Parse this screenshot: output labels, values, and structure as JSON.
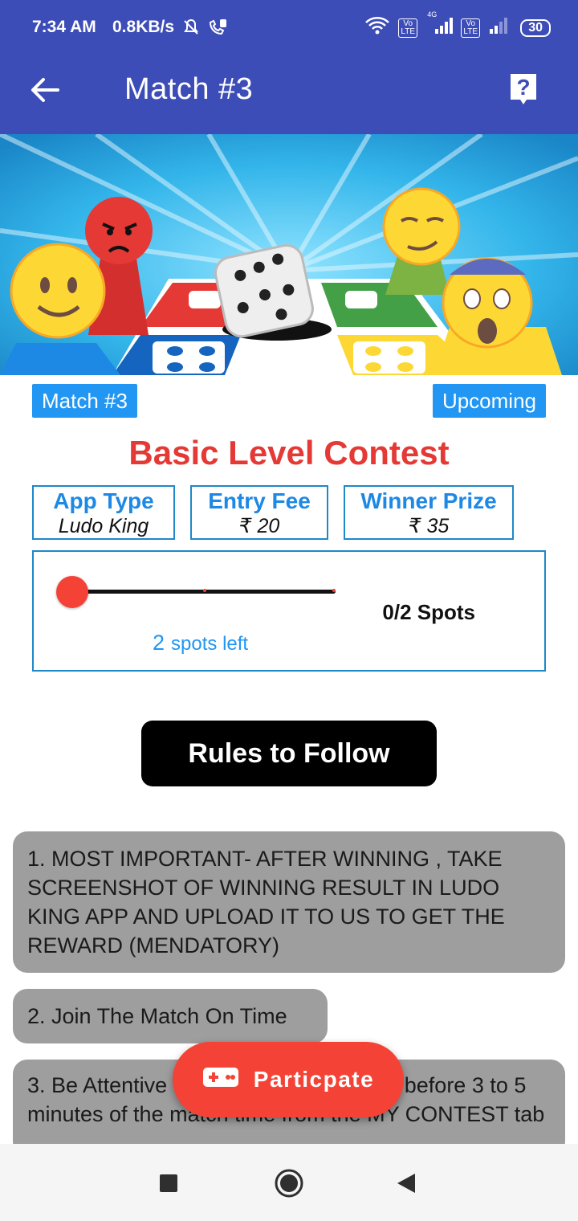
{
  "status_bar": {
    "time": "7:34 AM",
    "network_speed": "0.8KB/s",
    "battery": "30",
    "icons": [
      "mute-bell-icon",
      "call-icon",
      "wifi-icon",
      "volte-icon",
      "signal-icon",
      "battery-icon"
    ],
    "sim_tag_1": "Vo LTE",
    "network_type": "4G",
    "sim_tag_2": "Vo LTE"
  },
  "app_bar": {
    "title": "Match  #3",
    "back_icon": "arrow-left-icon",
    "help_icon": "help-icon"
  },
  "banner": {
    "image": "ludo-king-banner"
  },
  "match": {
    "number_badge": "Match  #3",
    "status_badge": "Upcoming",
    "contest_title": "Basic Level Contest"
  },
  "info": {
    "app_type_label": "App Type",
    "app_type_value": "Ludo King",
    "entry_fee_label": "Entry Fee",
    "entry_fee_value": "₹ 20",
    "winner_prize_label": "Winner Prize",
    "winner_prize_value": "₹ 35"
  },
  "spots": {
    "count_text": "0/2 Spots",
    "left_number": "2",
    "left_text": "spots left",
    "filled": 0,
    "total": 2
  },
  "rules": {
    "button_label": "Rules to Follow",
    "items": [
      "1. MOST IMPORTANT- AFTER WINNING , TAKE SCREENSHOT OF WINNING RESULT IN LUDO KING APP AND UPLOAD IT TO US TO GET THE REWARD (MENDATORY)",
      "2. Join The Match On Time",
      "3. Be Attentive to check the room code before 3 to 5 minutes of the match time from the MY CONTEST tab"
    ]
  },
  "fab": {
    "label": "Particpate",
    "icon": "gamepad-icon"
  },
  "nav": {
    "recents_icon": "square-icon",
    "home_icon": "circle-home-icon",
    "back_icon": "triangle-back-icon"
  },
  "colors": {
    "app_bar": "#3d4db7",
    "accent_blue": "#2196f3",
    "contest_red": "#e53935",
    "fab_red": "#f44336",
    "rule_bg": "#9e9e9e"
  }
}
